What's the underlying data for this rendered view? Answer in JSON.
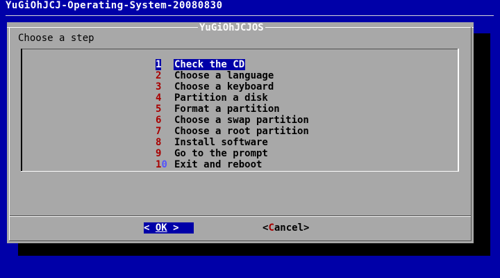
{
  "backtitle": "YuGiOhJCJ-Operating-System-20080830",
  "dialog": {
    "title": "YuGiOhJCJOS",
    "prompt": "Choose a step"
  },
  "menu": {
    "selected_index": 0,
    "items": [
      {
        "tag_hot": "1",
        "tag_rest": "",
        "label": "Check the CD"
      },
      {
        "tag_hot": "2",
        "tag_rest": "",
        "label": "Choose a language"
      },
      {
        "tag_hot": "3",
        "tag_rest": "",
        "label": "Choose a keyboard"
      },
      {
        "tag_hot": "4",
        "tag_rest": "",
        "label": "Partition a disk"
      },
      {
        "tag_hot": "5",
        "tag_rest": "",
        "label": "Format a partition"
      },
      {
        "tag_hot": "6",
        "tag_rest": "",
        "label": "Choose a swap partition"
      },
      {
        "tag_hot": "7",
        "tag_rest": "",
        "label": "Choose a root partition"
      },
      {
        "tag_hot": "8",
        "tag_rest": "",
        "label": "Install software"
      },
      {
        "tag_hot": "9",
        "tag_rest": "",
        "label": "Go to the prompt"
      },
      {
        "tag_hot": "1",
        "tag_rest": "0",
        "label": "Exit and reboot"
      }
    ]
  },
  "buttons": {
    "ok": {
      "left": "< ",
      "hot": "OK",
      "right": " >"
    },
    "cancel": {
      "left": "<",
      "hot": "C",
      "rest": "ancel",
      "right": ">"
    }
  },
  "colors": {
    "background": "#0000a8",
    "dialog": "#a8a8a8",
    "highlight": "#0000a8",
    "hotkey": "#a80000",
    "tag_secondary": "#5454fc",
    "text": "#000000",
    "light": "#fcfcfc"
  }
}
